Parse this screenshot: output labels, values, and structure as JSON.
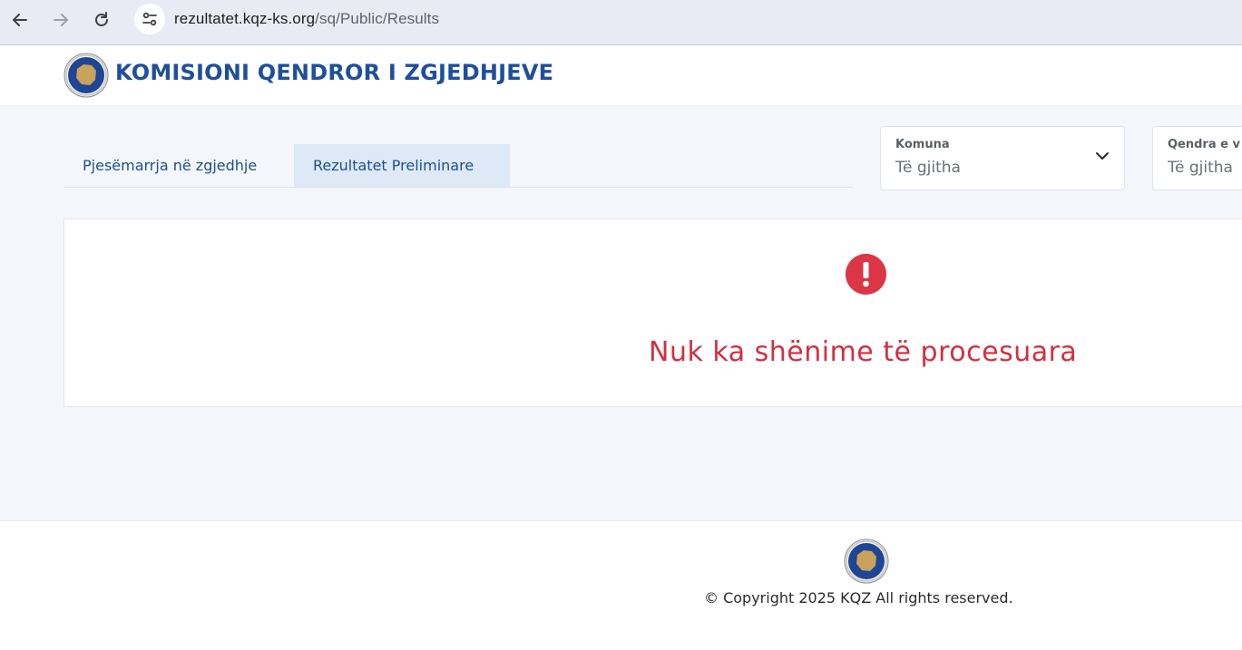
{
  "browser": {
    "back_icon": "arrow-left-icon",
    "forward_icon": "arrow-right-icon",
    "reload_icon": "reload-icon",
    "site_info_icon": "tune-icon",
    "url_host": "rezultatet.kqz-ks.org",
    "url_path": "/sq/Public/Results"
  },
  "header": {
    "title": "KOMISIONI QENDROR I ZGJEDHJEVE",
    "logo_icon": "kqz-emblem-icon"
  },
  "tabs": [
    {
      "label": "Pjesëmarrja në zgjedhje",
      "active": false
    },
    {
      "label": "Rezultatet Preliminare",
      "active": true
    }
  ],
  "filters": [
    {
      "label": "Komuna",
      "value": "Të gjitha"
    },
    {
      "label": "Qendra e v",
      "value": "Të gjitha"
    }
  ],
  "results": {
    "icon": "exclamation-circle-icon",
    "message": "Nuk ka shënime të procesuara"
  },
  "footer": {
    "copyright": "© Copyright 2025 KQZ All rights reserved."
  },
  "colors": {
    "brand_blue": "#1f4f9c",
    "alert_red": "#d42f3f",
    "active_tab_bg": "#dde9f6"
  }
}
